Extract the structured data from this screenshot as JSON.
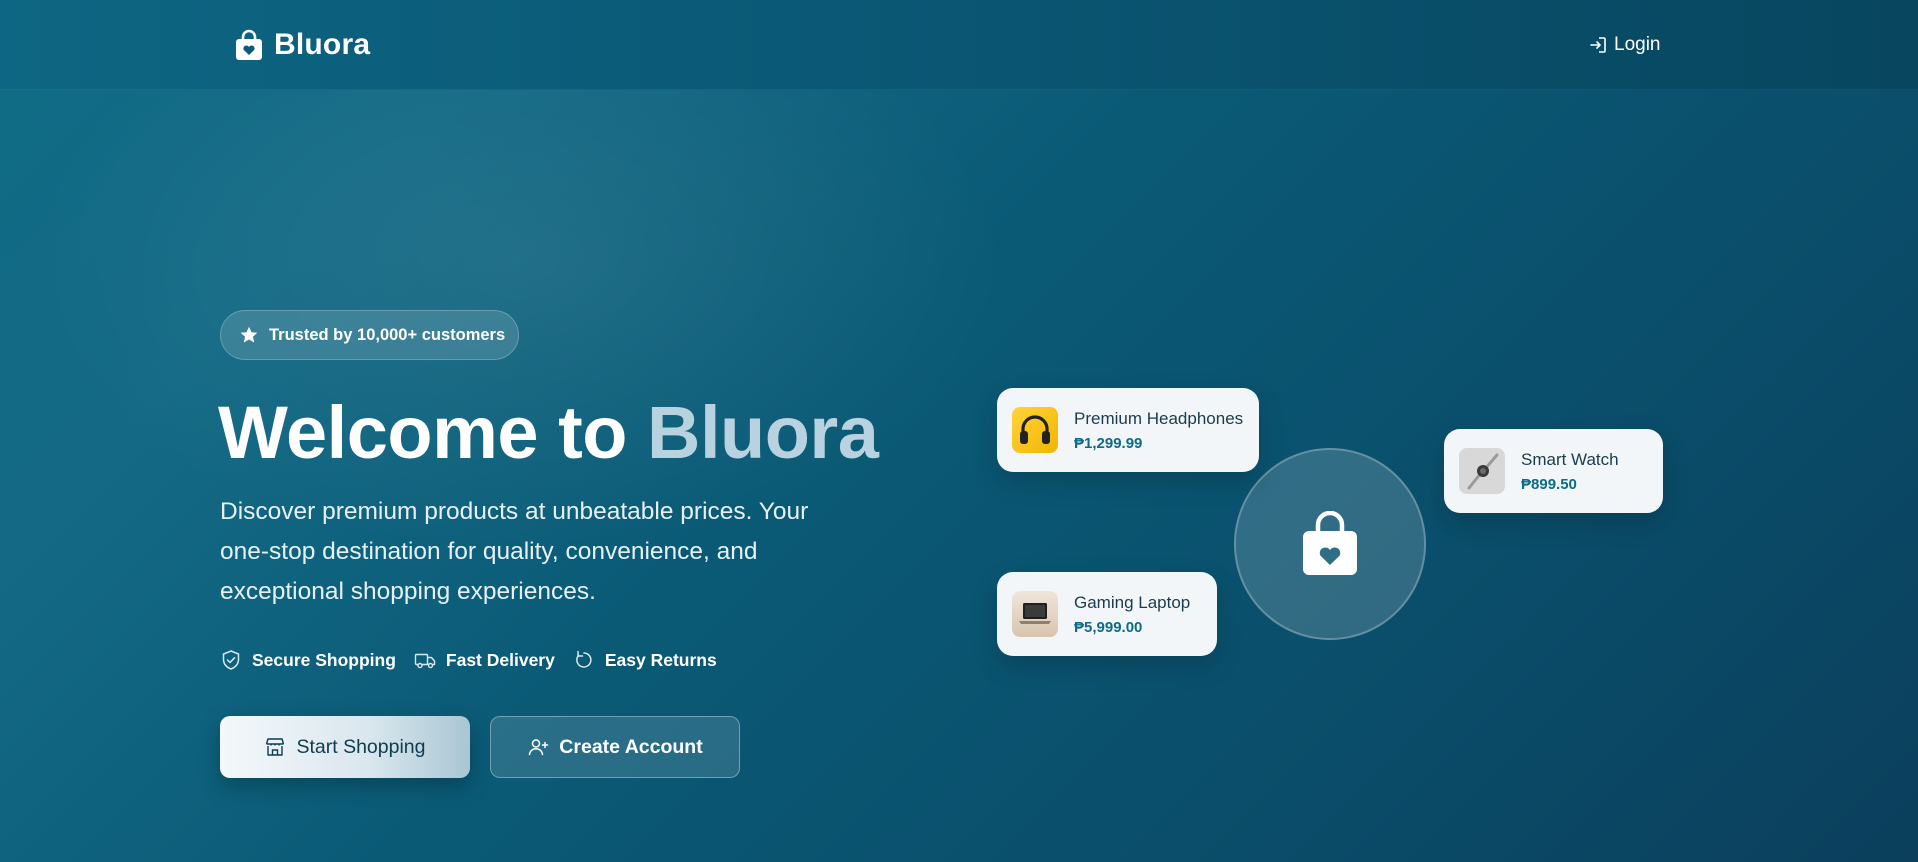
{
  "nav": {
    "brand": "Bluora",
    "login_label": "Login"
  },
  "hero": {
    "badge_text": "Trusted by 10,000+ customers",
    "title_prefix": "Welcome to ",
    "title_accent": "Bluora",
    "description": "Discover premium products at unbeatable prices. Your one-stop destination for quality, convenience, and exceptional shopping experiences.",
    "features": [
      {
        "icon": "shield-check-icon",
        "label": "Secure Shopping"
      },
      {
        "icon": "truck-icon",
        "label": "Fast Delivery"
      },
      {
        "icon": "rotate-icon",
        "label": "Easy Returns"
      }
    ],
    "primary_button": "Start Shopping",
    "secondary_button": "Create Account"
  },
  "products": [
    {
      "name": "Premium Headphones",
      "price": "₱1,299.99",
      "thumb": "headphones"
    },
    {
      "name": "Smart Watch",
      "price": "₱899.50",
      "thumb": "watch"
    },
    {
      "name": "Gaming Laptop",
      "price": "₱5,999.00",
      "thumb": "laptop"
    }
  ],
  "colors": {
    "background_start": "#0f6b85",
    "background_end": "#0b3f5c",
    "accent_text": "#b8d3df",
    "price": "#0e6b86",
    "card": "#f2f6f8"
  }
}
